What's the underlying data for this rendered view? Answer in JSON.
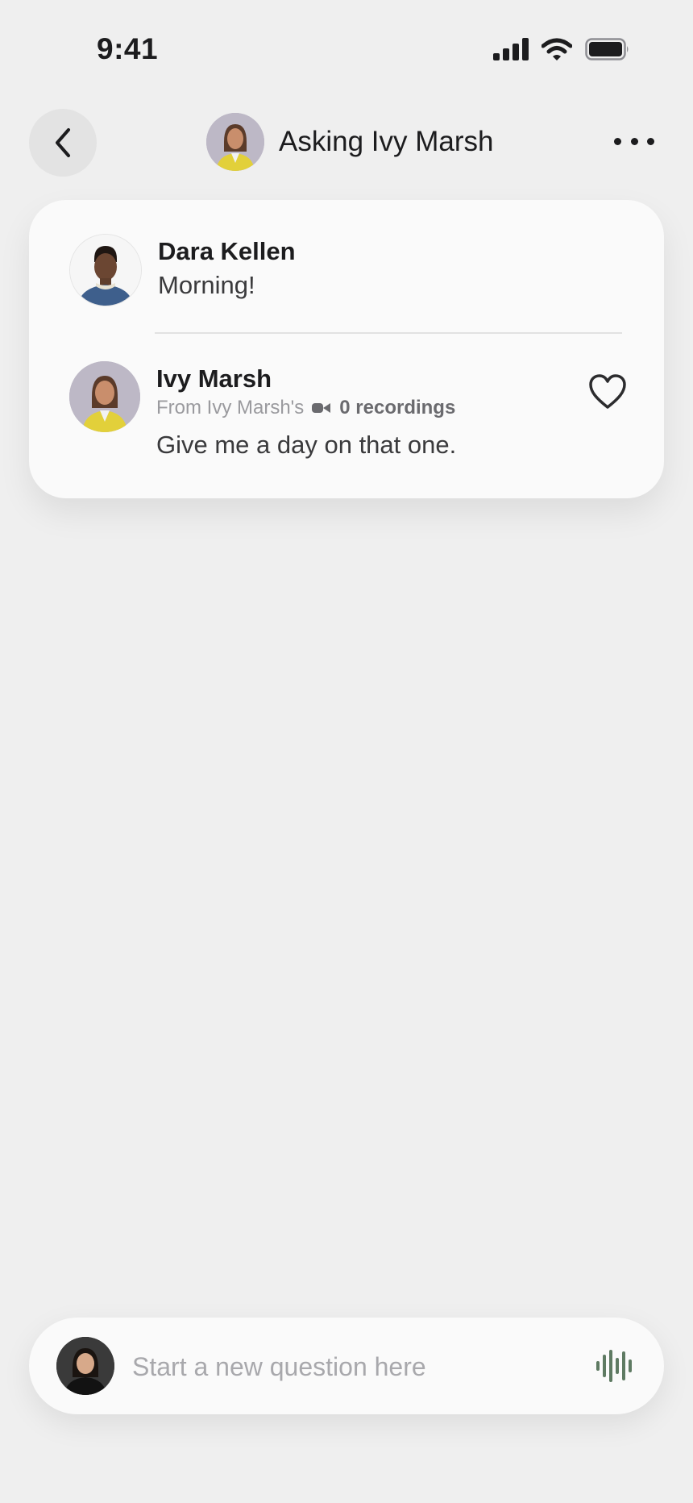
{
  "status": {
    "time": "9:41"
  },
  "header": {
    "title": "Asking Ivy Marsh"
  },
  "thread": {
    "messages": [
      {
        "name": "Dara Kellen",
        "text": "Morning!"
      },
      {
        "name": "Ivy Marsh",
        "source": "From Ivy Marsh's",
        "recordings": "0 recordings",
        "text": "Give me a day on that one."
      }
    ]
  },
  "composer": {
    "placeholder": "Start a new question here"
  },
  "colors": {
    "background": "#efefef",
    "card": "#fafafa",
    "voice_accent": "#5e7a62"
  },
  "icons": [
    "back-chevron-icon",
    "more-dots-icon",
    "heart-icon",
    "recording-icon",
    "voice-waveform-icon",
    "signal-icon",
    "wifi-icon",
    "battery-icon"
  ]
}
